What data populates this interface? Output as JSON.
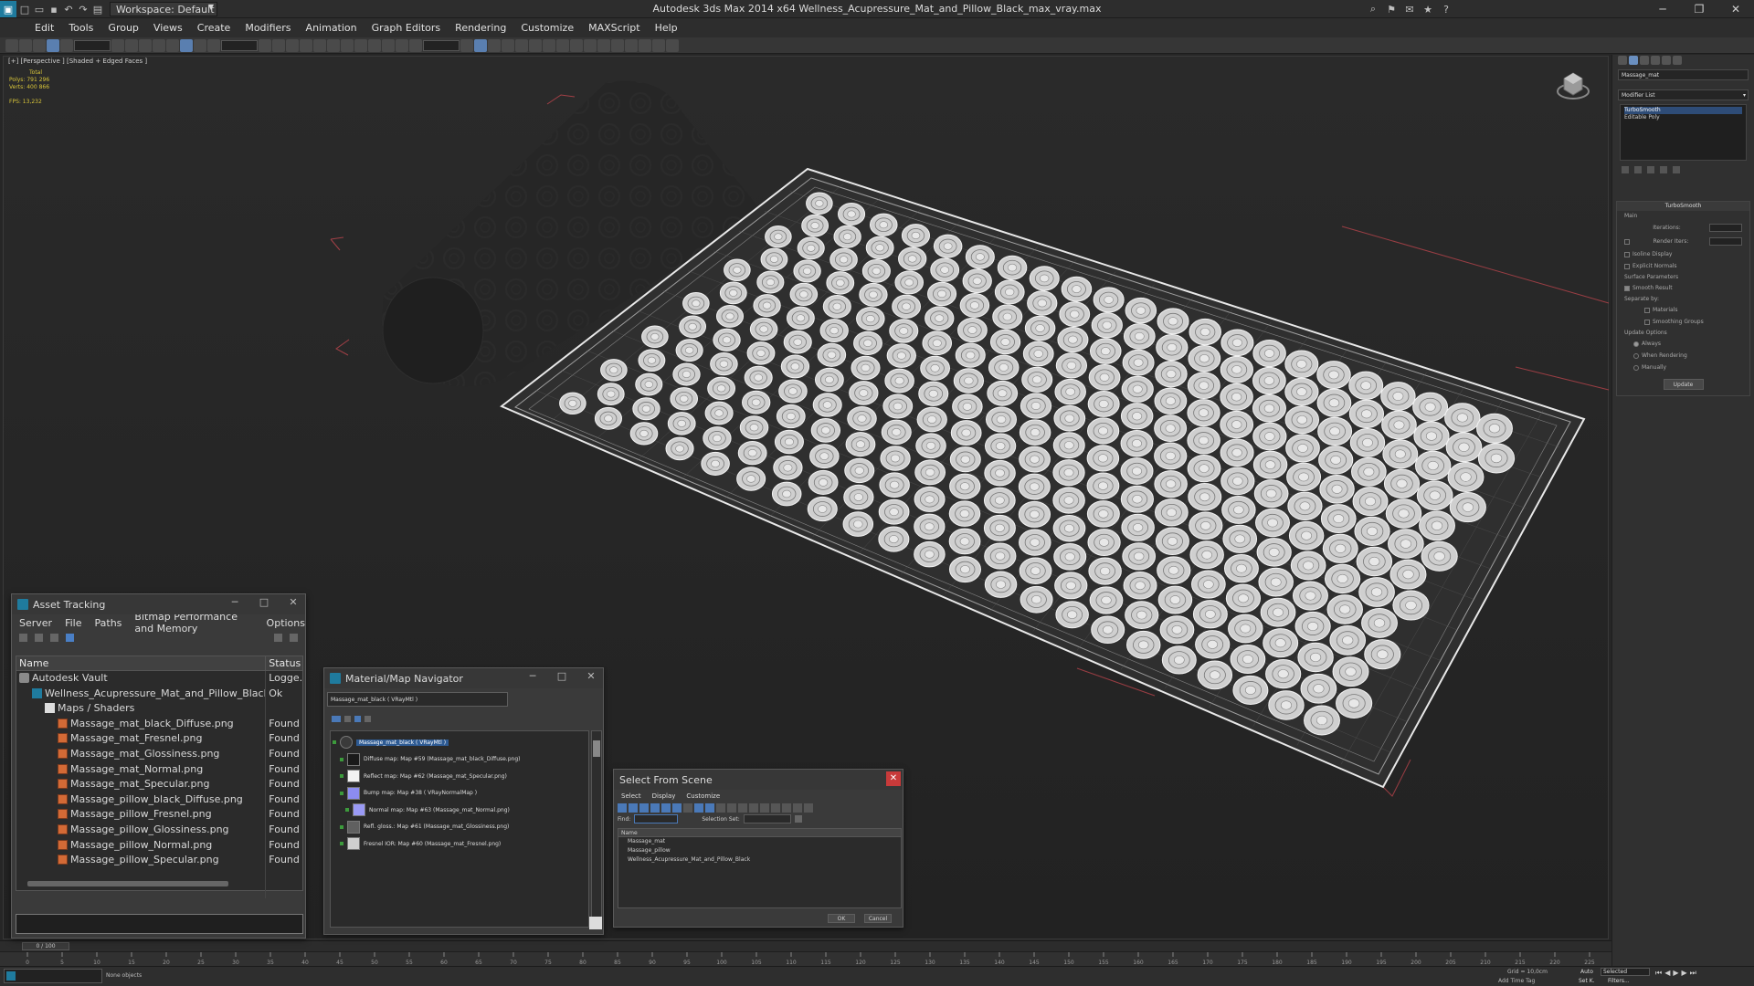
{
  "window": {
    "title": "Autodesk 3ds Max  2014 x64    Wellness_Acupressure_Mat_and_Pillow_Black_max_vray.max",
    "workspace": "Workspace: Default"
  },
  "menu": [
    "Edit",
    "Tools",
    "Group",
    "Views",
    "Create",
    "Modifiers",
    "Animation",
    "Graph Editors",
    "Rendering",
    "Customize",
    "MAXScript",
    "Help"
  ],
  "viewport": {
    "label": "[+] [Perspective ] [Shaded + Edged Faces ]",
    "stats": {
      "total_label": "Total",
      "polys": "Polys:  791 296",
      "verts": "Verts:  400 866",
      "fps": "FPS:    13,232"
    }
  },
  "command_panel": {
    "object_name": "Massage_mat",
    "modifier_list": "Modifier List",
    "stack": [
      "TurboSmooth",
      "Editable Poly"
    ],
    "rollout_title": "TurboSmooth",
    "main_label": "Main",
    "iterations": "Iterations:",
    "render_iters": "Render Iters:",
    "isoline": "Isoline Display",
    "explicit_normals": "Explicit Normals",
    "surface_params": "Surface Parameters",
    "smooth_result": "Smooth Result",
    "separate_by": "Separate by:",
    "materials": "Materials",
    "smoothing_groups": "Smoothing Groups",
    "update_options": "Update Options",
    "always": "Always",
    "when_rendering": "When Rendering",
    "manually": "Manually",
    "update_btn": "Update"
  },
  "asset_tracking": {
    "title": "Asset Tracking",
    "menu": [
      "Server",
      "File",
      "Paths",
      "Bitmap Performance and Memory",
      "Options"
    ],
    "columns": [
      "Name",
      "Status"
    ],
    "rows": [
      {
        "name": "Autodesk Vault",
        "status": "Logge...",
        "icon": "vault",
        "indent": 0
      },
      {
        "name": "Wellness_Acupressure_Mat_and_Pillow_Black_max_vr...",
        "status": "Ok",
        "icon": "max",
        "indent": 1
      },
      {
        "name": "Maps / Shaders",
        "status": "",
        "icon": "fold",
        "indent": 2
      },
      {
        "name": "Massage_mat_black_Diffuse.png",
        "status": "Found",
        "icon": "png",
        "indent": 3
      },
      {
        "name": "Massage_mat_Fresnel.png",
        "status": "Found",
        "icon": "png",
        "indent": 3
      },
      {
        "name": "Massage_mat_Glossiness.png",
        "status": "Found",
        "icon": "png",
        "indent": 3
      },
      {
        "name": "Massage_mat_Normal.png",
        "status": "Found",
        "icon": "png",
        "indent": 3
      },
      {
        "name": "Massage_mat_Specular.png",
        "status": "Found",
        "icon": "png",
        "indent": 3
      },
      {
        "name": "Massage_pillow_black_Diffuse.png",
        "status": "Found",
        "icon": "png",
        "indent": 3
      },
      {
        "name": "Massage_pillow_Fresnel.png",
        "status": "Found",
        "icon": "png",
        "indent": 3
      },
      {
        "name": "Massage_pillow_Glossiness.png",
        "status": "Found",
        "icon": "png",
        "indent": 3
      },
      {
        "name": "Massage_pillow_Normal.png",
        "status": "Found",
        "icon": "png",
        "indent": 3
      },
      {
        "name": "Massage_pillow_Specular.png",
        "status": "Found",
        "icon": "png",
        "indent": 3
      }
    ]
  },
  "material_navigator": {
    "title": "Material/Map Navigator",
    "path": "Massage_mat_black  ( VRayMtl )",
    "nodes": [
      {
        "label": "Massage_mat_black  ( VRayMtl )",
        "swatch": "#3a3a3a",
        "selected": true
      },
      {
        "label": "Diffuse map: Map #59 (Massage_mat_black_Diffuse.png)",
        "swatch": "#1a1a1a",
        "selected": false
      },
      {
        "label": "Reflect map: Map #62 (Massage_mat_Specular.png)",
        "swatch": "#f2f2f2",
        "selected": false
      },
      {
        "label": "Bump map: Map #38  ( VRayNormalMap )",
        "swatch": "#8c8cf0",
        "selected": false
      },
      {
        "label": "Normal map: Map #63 (Massage_mat_Normal.png)",
        "swatch": "#9a9af5",
        "selected": false
      },
      {
        "label": "Refl. gloss.: Map #61 (Massage_mat_Glossiness.png)",
        "swatch": "#606060",
        "selected": false
      },
      {
        "label": "Fresnel IOR: Map #60 (Massage_mat_Fresnel.png)",
        "swatch": "#cfcfcf",
        "selected": false
      }
    ]
  },
  "select_scene": {
    "title": "Select From Scene",
    "menu": [
      "Select",
      "Display",
      "Customize"
    ],
    "find_label": "Find:",
    "selection_set_label": "Selection Set:",
    "column": "Name",
    "items": [
      "Massage_mat",
      "Massage_pillow",
      "Wellness_Acupressure_Mat_and_Pillow_Black"
    ],
    "ok": "OK",
    "cancel": "Cancel"
  },
  "timeline": {
    "frame": "0 / 100",
    "ticks": [
      "0",
      "5",
      "10",
      "15",
      "20",
      "25",
      "30",
      "35",
      "40",
      "45",
      "50",
      "55",
      "60",
      "65",
      "70",
      "75",
      "80",
      "85",
      "90",
      "95",
      "100",
      "105",
      "110",
      "115",
      "120",
      "125",
      "130",
      "135",
      "140",
      "145",
      "150",
      "155",
      "160",
      "165",
      "170",
      "175",
      "180",
      "185",
      "190",
      "195",
      "200",
      "205",
      "210",
      "215",
      "220",
      "225"
    ]
  },
  "statusbar": {
    "left": "None objects",
    "grid": "Grid = 10,0cm",
    "autokey": "Auto",
    "selected": "Selected",
    "setkey": "Set K.",
    "filters": "Filters...",
    "addtimetag": "Add Time Tag"
  }
}
